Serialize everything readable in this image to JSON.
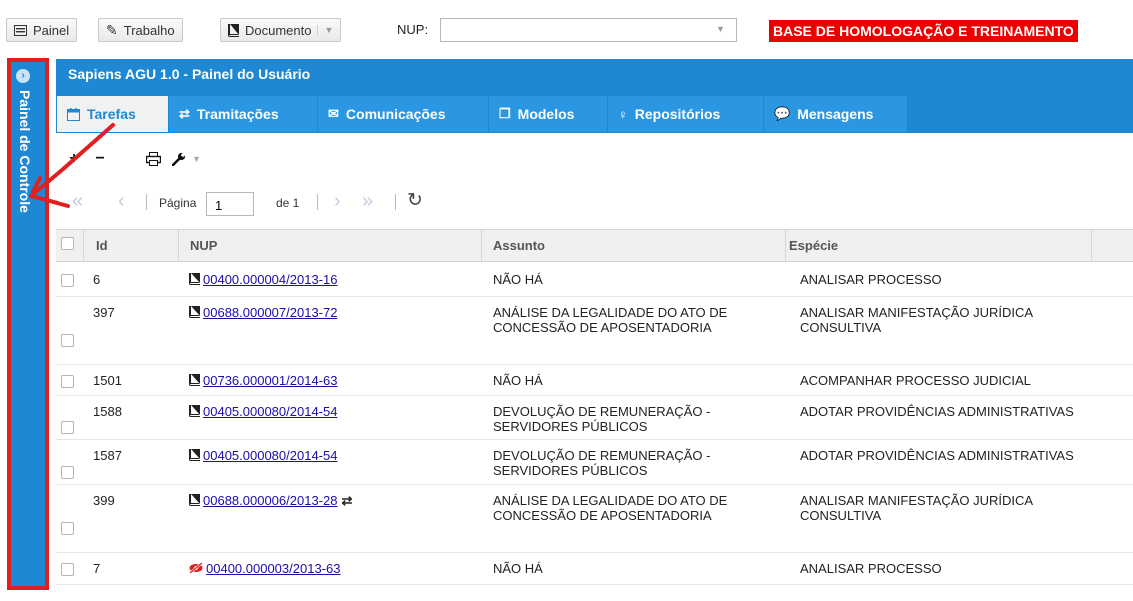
{
  "topbar": {
    "painel": "Painel",
    "trabalho": "Trabalho",
    "documento": "Documento",
    "nup_label": "NUP:",
    "nup_value": "",
    "banner": "BASE DE HOMOLOGAÇÃO E TREINAMENTO"
  },
  "left_panel": {
    "title": "Painel de Controle"
  },
  "main": {
    "title": "Sapiens AGU 1.0 - Painel do Usuário",
    "tabs": [
      {
        "label": "Tarefas",
        "icon": "calendar-icon"
      },
      {
        "label": "Tramitações",
        "icon": "exchange-icon"
      },
      {
        "label": "Comunicações",
        "icon": "envelope-icon"
      },
      {
        "label": "Modelos",
        "icon": "copy-icon"
      },
      {
        "label": "Repositórios",
        "icon": "lightbulb-icon"
      },
      {
        "label": "Mensagens",
        "icon": "comments-icon"
      }
    ],
    "active_tab": "Tarefas"
  },
  "pager": {
    "label": "Página",
    "page": "1",
    "of": "de 1"
  },
  "grid": {
    "columns": [
      "Id",
      "NUP",
      "Assunto",
      "Espécie"
    ],
    "rows": [
      {
        "id": "6",
        "nup": "00400.000004/2013-16",
        "assunto": "NÃO HÁ",
        "especie": "ANALISAR PROCESSO",
        "icon": "book-icon"
      },
      {
        "id": "397",
        "nup": "00688.000007/2013-72",
        "assunto": "ANÁLISE DA LEGALIDADE DO ATO DE CONCESSÃO DE APOSENTADORIA",
        "especie": "ANALISAR MANIFESTAÇÃO JURÍDICA CONSULTIVA",
        "icon": "book-icon"
      },
      {
        "id": "1501",
        "nup": "00736.000001/2014-63",
        "assunto": "NÃO HÁ",
        "especie": "ACOMPANHAR PROCESSO JUDICIAL",
        "icon": "book-icon"
      },
      {
        "id": "1588",
        "nup": "00405.000080/2014-54",
        "assunto": "DEVOLUÇÃO DE REMUNERAÇÃO - SERVIDORES PÚBLICOS",
        "especie": "ADOTAR PROVIDÊNCIAS ADMINISTRATIVAS",
        "icon": "book-icon"
      },
      {
        "id": "1587",
        "nup": "00405.000080/2014-54",
        "assunto": "DEVOLUÇÃO DE REMUNERAÇÃO - SERVIDORES PÚBLICOS",
        "especie": "ADOTAR PROVIDÊNCIAS ADMINISTRATIVAS",
        "icon": "book-icon"
      },
      {
        "id": "399",
        "nup": "00688.000006/2013-28",
        "assunto": "ANÁLISE DA LEGALIDADE DO ATO DE CONCESSÃO DE APOSENTADORIA",
        "especie": "ANALISAR MANIFESTAÇÃO JURÍDICA CONSULTIVA",
        "icon": "book-icon"
      },
      {
        "id": "7",
        "nup": "00400.000003/2013-63",
        "assunto": "NÃO HÁ",
        "especie": "ANALISAR PROCESSO",
        "icon": "eye-slash-icon"
      }
    ]
  },
  "colors": {
    "primary": "#1f88d4",
    "banner": "#ee0000",
    "annotation": "#e02020",
    "link": "#1a0dab"
  }
}
